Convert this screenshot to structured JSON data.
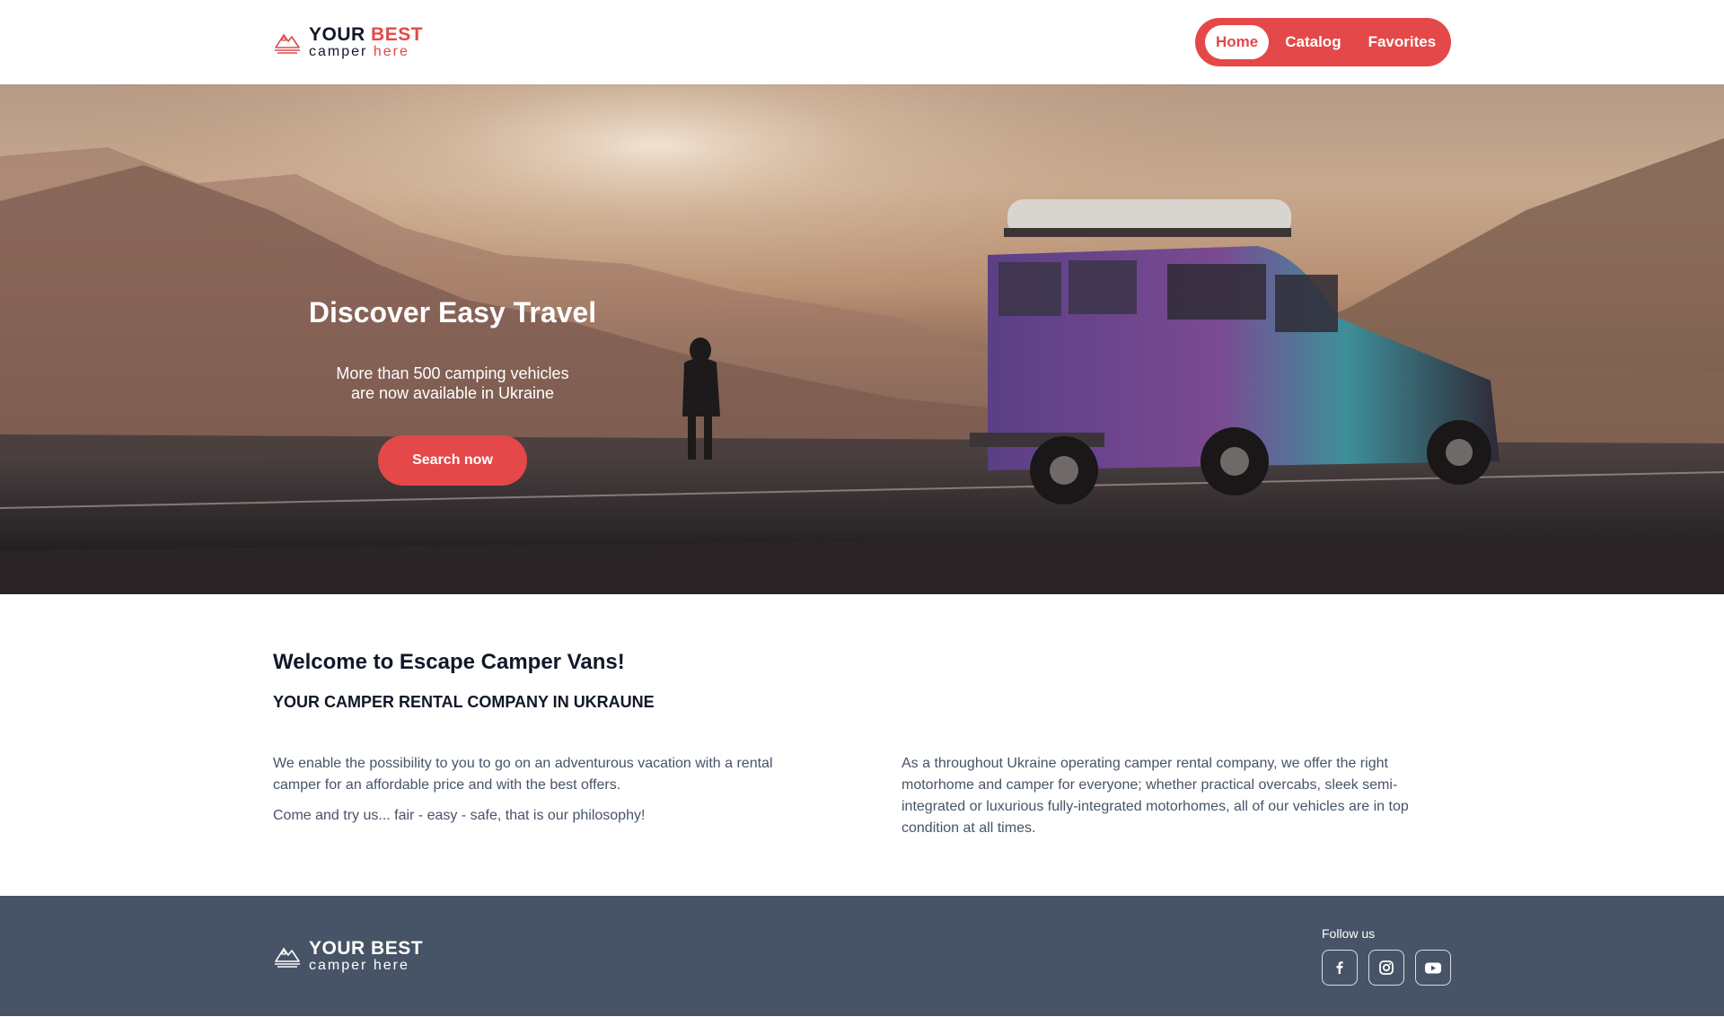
{
  "brand": {
    "line1_main": "YOUR",
    "line1_accent": "BEST",
    "line2_main": "camper",
    "line2_accent": "here",
    "accent_color": "#e44848"
  },
  "nav": {
    "items": [
      {
        "label": "Home",
        "active": true
      },
      {
        "label": "Catalog",
        "active": false
      },
      {
        "label": "Favorites",
        "active": false
      }
    ]
  },
  "hero": {
    "title": "Discover Easy Travel",
    "subtitle_line1": "More than 500 camping vehicles",
    "subtitle_line2": "are now available in Ukraine",
    "cta_label": "Search now"
  },
  "welcome": {
    "title": "Welcome to Escape Camper Vans!",
    "subtitle": "YOUR CAMPER RENTAL COMPANY IN UKRAUNE",
    "left_p1": "We enable the possibility to you to go on an adventurous vacation with a rental camper for an affordable price and with the best offers.",
    "left_p2": "Come and try us... fair - easy - safe, that is our philosophy!",
    "right_p1": "As a throughout Ukraine operating camper rental company, we offer the right motorhome and camper for everyone; whether practical overcabs, sleek semi-integrated or luxurious fully-integrated motorhomes, all of our vehicles are in top condition at all times."
  },
  "footer": {
    "brand_line1_main": "YOUR",
    "brand_line1_accent": "BEST",
    "brand_line2_main": "camper",
    "brand_line2_accent": "here",
    "follow_label": "Follow us",
    "socials": [
      {
        "icon": "facebook-icon"
      },
      {
        "icon": "instagram-icon"
      },
      {
        "icon": "youtube-icon"
      }
    ],
    "background_color": "#475467"
  }
}
